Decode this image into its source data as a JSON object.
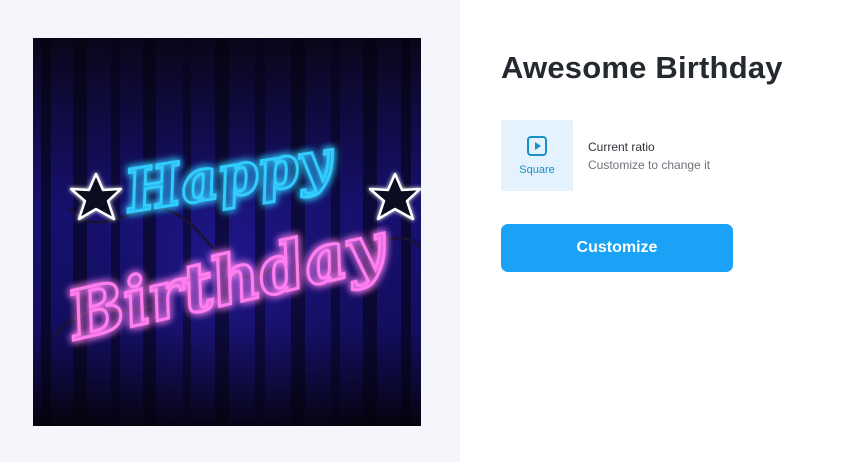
{
  "preview": {
    "neon_line1": "Happy",
    "neon_line2": "Birthday"
  },
  "details": {
    "title": "Awesome Birthday",
    "ratio": {
      "badge_icon": "play-square-icon",
      "badge_label": "Square",
      "current_label": "Current ratio",
      "hint": "Customize to change it"
    },
    "customize_label": "Customize"
  },
  "colors": {
    "accent_button": "#1aa3f6",
    "ratio_badge_bg": "#e3f2fd",
    "ratio_badge_text": "#1a8fc8",
    "neon_blue": "#33ccff",
    "neon_pink": "#ff7ef0"
  }
}
